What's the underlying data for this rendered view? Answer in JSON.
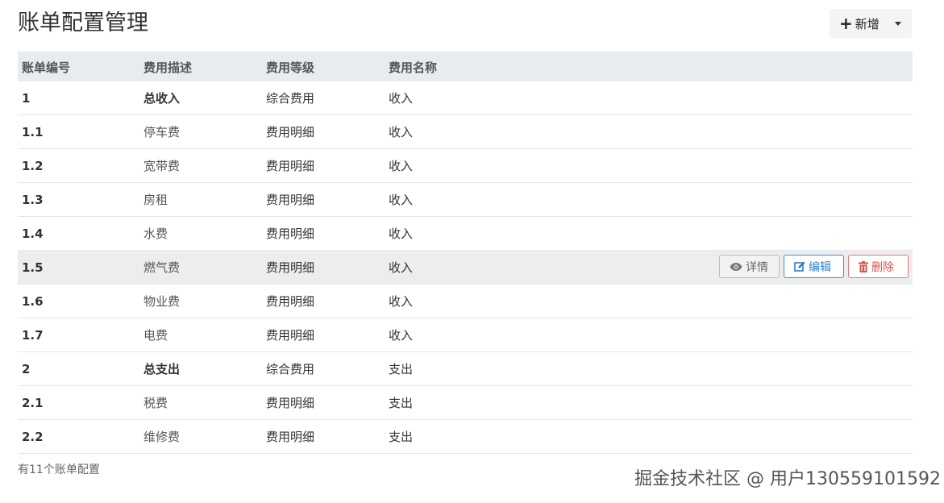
{
  "header": {
    "title": "账单配置管理",
    "add_label": "新增"
  },
  "table": {
    "columns": [
      "账单编号",
      "费用描述",
      "费用等级",
      "费用名称"
    ],
    "rows": [
      {
        "id": "1",
        "desc": "总收入",
        "level": "综合费用",
        "name": "收入",
        "bold": true
      },
      {
        "id": "1.1",
        "desc": "停车费",
        "level": "费用明细",
        "name": "收入"
      },
      {
        "id": "1.2",
        "desc": "宽带费",
        "level": "费用明细",
        "name": "收入"
      },
      {
        "id": "1.3",
        "desc": "房租",
        "level": "费用明细",
        "name": "收入"
      },
      {
        "id": "1.4",
        "desc": "水费",
        "level": "费用明细",
        "name": "收入"
      },
      {
        "id": "1.5",
        "desc": "燃气费",
        "level": "费用明细",
        "name": "收入",
        "hover": true
      },
      {
        "id": "1.6",
        "desc": "物业费",
        "level": "费用明细",
        "name": "收入"
      },
      {
        "id": "1.7",
        "desc": "电费",
        "level": "费用明细",
        "name": "收入"
      },
      {
        "id": "2",
        "desc": "总支出",
        "level": "综合费用",
        "name": "支出",
        "bold": true
      },
      {
        "id": "2.1",
        "desc": "税费",
        "level": "费用明细",
        "name": "支出"
      },
      {
        "id": "2.2",
        "desc": "维修费",
        "level": "费用明细",
        "name": "支出"
      }
    ],
    "actions": {
      "view": "详情",
      "edit": "编辑",
      "delete": "删除"
    }
  },
  "footer": {
    "count_text": "有11个账单配置"
  },
  "watermark": "掘金技术社区 @ 用户130559101592",
  "colors": {
    "header_bg": "#e8ebef",
    "hover_row": "#ededed",
    "edit_blue": "#2a7fcc",
    "delete_red": "#d9534f"
  }
}
